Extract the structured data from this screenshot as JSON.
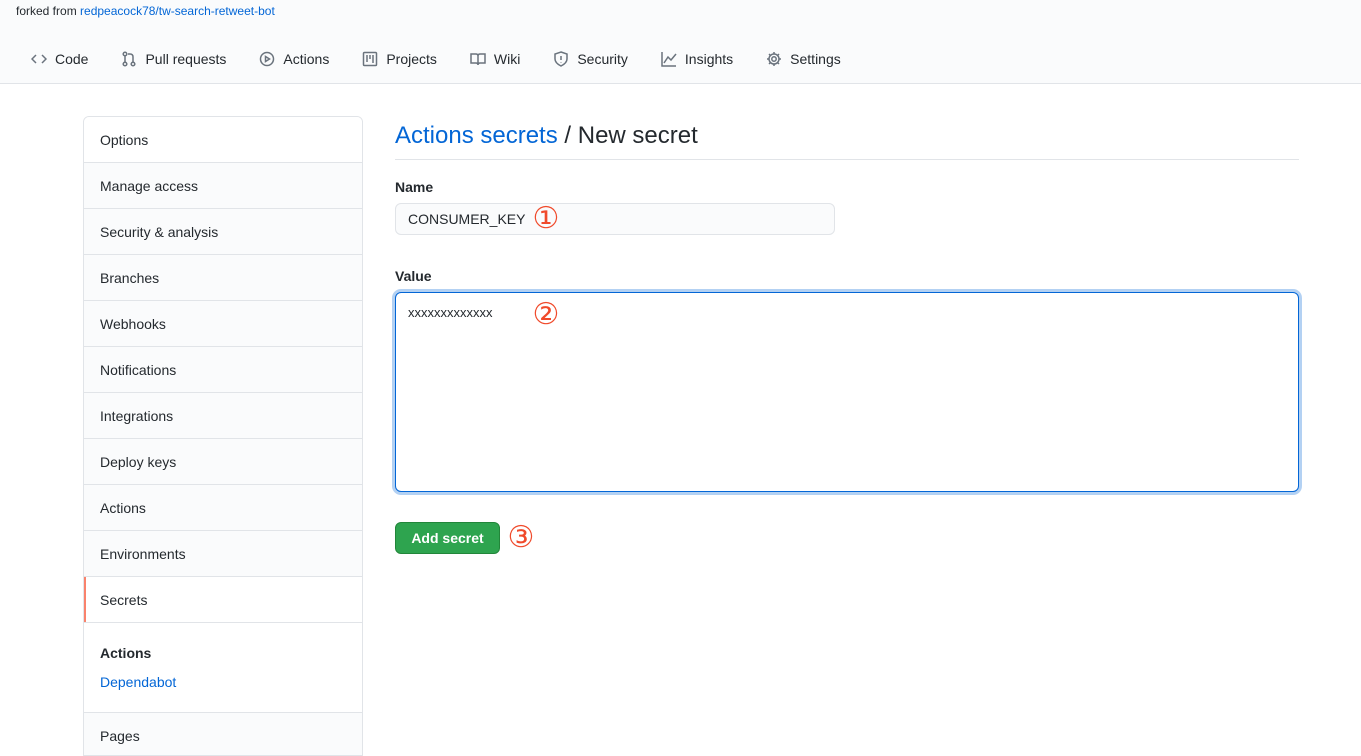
{
  "repo": {
    "forked_prefix": "forked from",
    "forked_link": "redpeacock78/tw-search-retweet-bot"
  },
  "tabs": [
    {
      "label": "Code",
      "icon": "code-icon"
    },
    {
      "label": "Pull requests",
      "icon": "pull-request-icon"
    },
    {
      "label": "Actions",
      "icon": "play-icon"
    },
    {
      "label": "Projects",
      "icon": "project-icon"
    },
    {
      "label": "Wiki",
      "icon": "book-icon"
    },
    {
      "label": "Security",
      "icon": "shield-icon"
    },
    {
      "label": "Insights",
      "icon": "graph-icon"
    },
    {
      "label": "Settings",
      "icon": "gear-icon"
    }
  ],
  "sidebar": {
    "items": [
      {
        "label": "Options"
      },
      {
        "label": "Manage access"
      },
      {
        "label": "Security & analysis"
      },
      {
        "label": "Branches"
      },
      {
        "label": "Webhooks"
      },
      {
        "label": "Notifications"
      },
      {
        "label": "Integrations"
      },
      {
        "label": "Deploy keys"
      },
      {
        "label": "Actions"
      },
      {
        "label": "Environments"
      },
      {
        "label": "Secrets",
        "selected": true
      }
    ],
    "secrets_group": {
      "title": "Actions",
      "link": "Dependabot"
    },
    "pages": "Pages"
  },
  "main": {
    "breadcrumb": "Actions secrets",
    "separator": "/",
    "title": "New secret",
    "name_label": "Name",
    "name_value": "CONSUMER_KEY",
    "value_label": "Value",
    "value_value": "xxxxxxxxxxxxx",
    "submit_label": "Add secret"
  },
  "annotations": {
    "marker_1": "①",
    "marker_2": "②",
    "marker_3": "③"
  },
  "colors": {
    "accent": "#0366d6",
    "button": "#2ea44f",
    "selected_border": "#f9826c",
    "annotation": "#f04a2b"
  }
}
